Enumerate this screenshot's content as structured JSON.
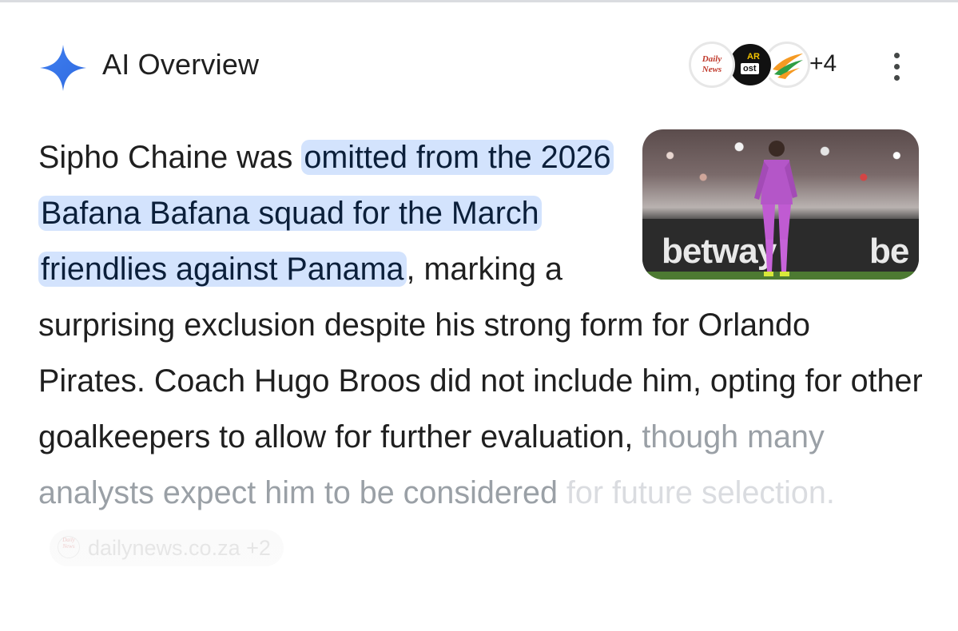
{
  "header": {
    "title": "AI Overview",
    "sources": [
      {
        "icon": "daily-news-logo-icon",
        "line1": "Daily",
        "line2": "News"
      },
      {
        "icon": "star-post-logo-icon",
        "line1": "AR",
        "line2": "ost"
      },
      {
        "icon": "flag-swoosh-logo-icon"
      }
    ],
    "more_sources": "+4",
    "menu_icon": "more-vert-icon"
  },
  "thumbnail": {
    "brand_left": "betway",
    "brand_right": "be"
  },
  "overview": {
    "lead": "Sipho Chaine was ",
    "highlight": "omitted from the 2026 Bafana Bafana squad for the March friendlies against Panama",
    "rest": ", marking a surprising exclusion despite his strong form for Orlando Pirates. Coach Hugo Broos did not include him, opting for other goalkeepers to allow for further evaluation, ",
    "faded": "though many analysts expect him to be considered ",
    "faded_more": "for future selection."
  },
  "citation": {
    "icon_line1": "Daily",
    "icon_line2": "News",
    "site": "dailynews.co.za",
    "extra": "+2"
  },
  "colors": {
    "highlight_bg": "#d3e3fd",
    "sparkle_blue": "#4285f4",
    "text": "#1f1f1f",
    "faded_text": "#9aa0a6"
  }
}
